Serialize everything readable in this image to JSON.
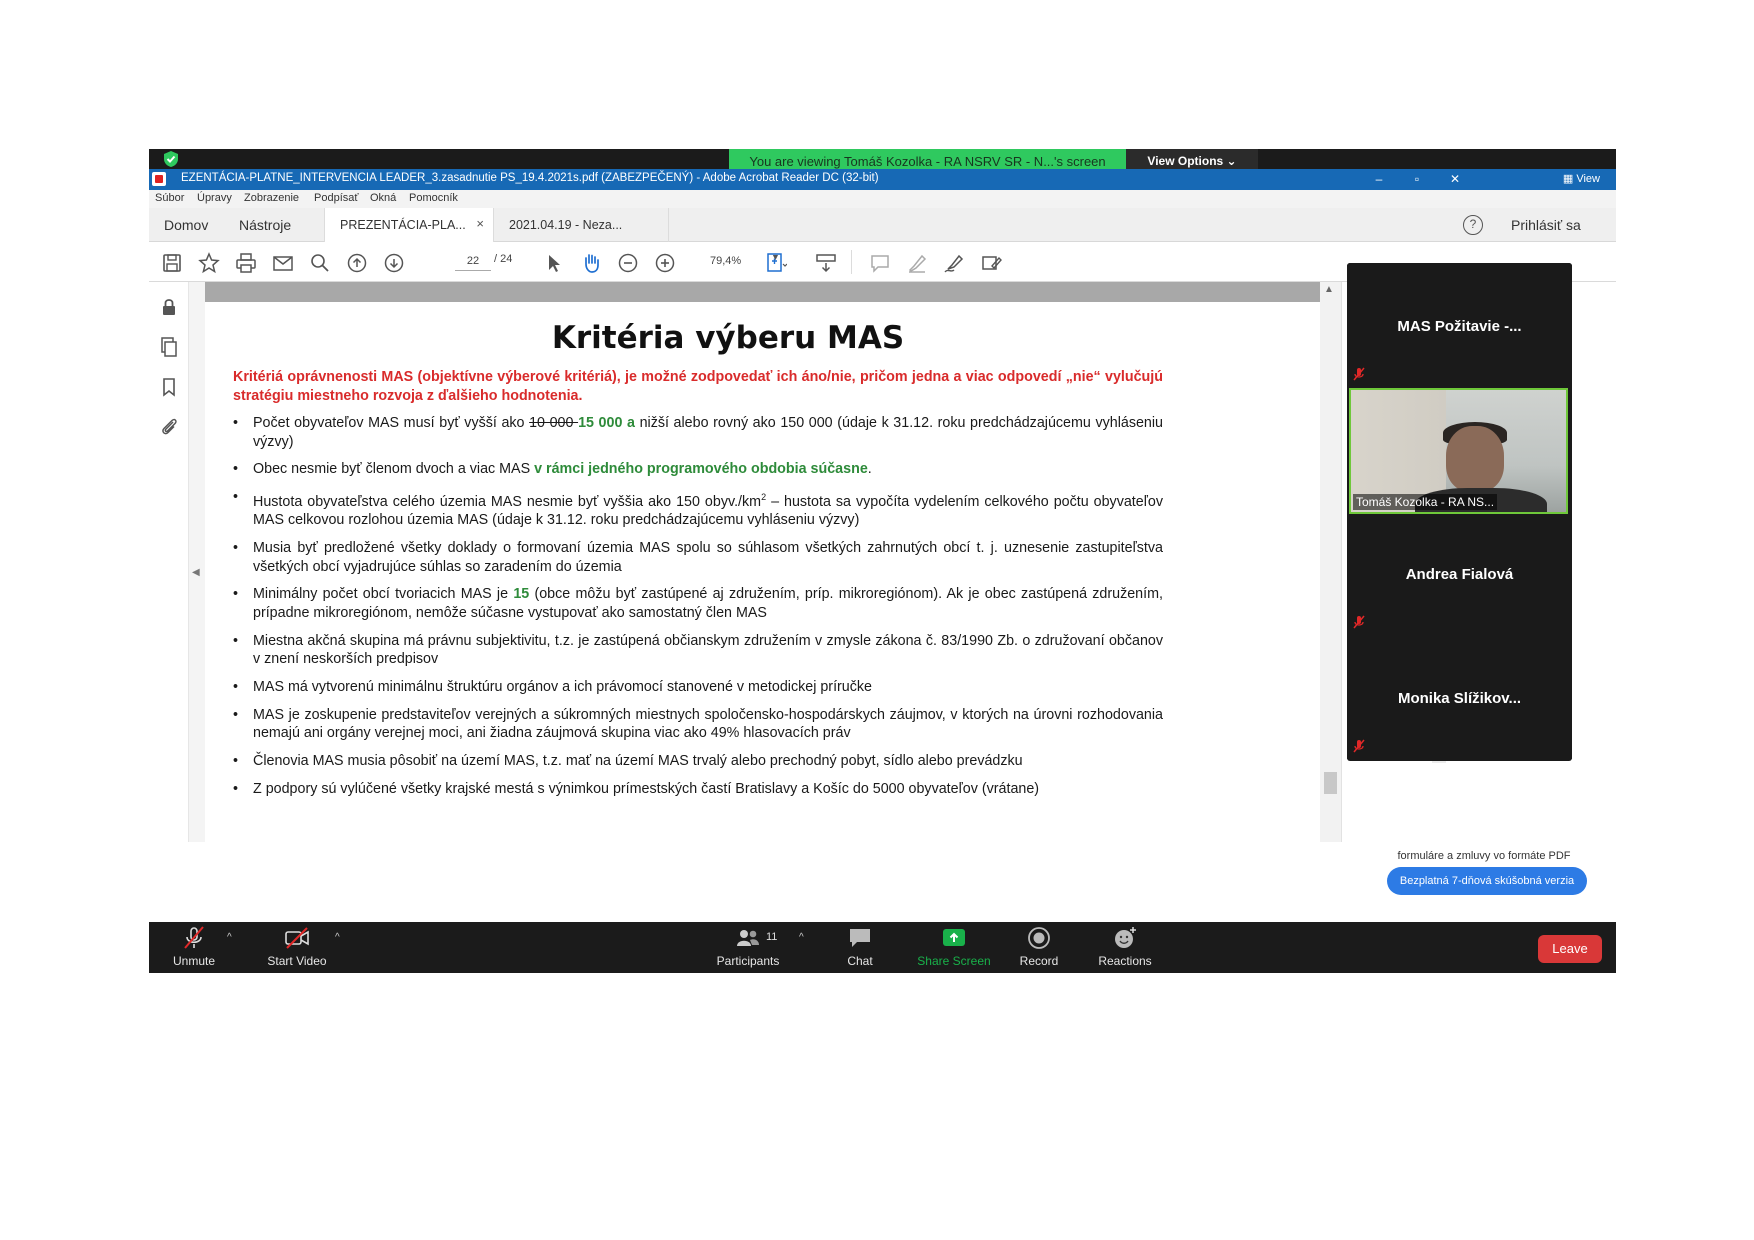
{
  "zoom": {
    "banner_text": "You are viewing Tomáš Kozolka - RA NSRV SR - N...'s screen",
    "view_options_label": "View Options ⌄",
    "view_label": "View",
    "participants_count": "11",
    "toolbar": {
      "unmute": "Unmute",
      "start_video": "Start Video",
      "participants": "Participants",
      "chat": "Chat",
      "share_screen": "Share Screen",
      "record": "Record",
      "reactions": "Reactions",
      "leave": "Leave"
    },
    "gallery": [
      {
        "name": "MAS Požitavie -..."
      },
      {
        "name": "Tomáš Kozolka - RA NS..."
      },
      {
        "name": "Andrea Fialová"
      },
      {
        "name": "Monika Slížikov..."
      }
    ],
    "colors": {
      "banner_green": "#2fc95f",
      "leave_red": "#d93838",
      "share_green": "#19b14a",
      "active_speaker": "#6fc83a"
    }
  },
  "acrobat": {
    "title": "EZENTÁCIA-PLATNE_INTERVENCIA LEADER_3.zasadnutie PS_19.4.2021s.pdf (ZABEZPEČENÝ) - Adobe Acrobat Reader DC (32-bit)",
    "menu": [
      "Súbor",
      "Úpravy",
      "Zobrazenie",
      "Podpísať",
      "Okná",
      "Pomocník"
    ],
    "nav_home": "Domov",
    "nav_tools": "Nástroje",
    "tabs": [
      {
        "label": "PREZENTÁCIA-PLA...",
        "close": "×"
      },
      {
        "label": "2021.04.19  - Neza..."
      }
    ],
    "help": "?",
    "sign_in": "Prihlásiť sa",
    "page_current": "22",
    "page_total": "/ 24",
    "zoom_level": "79,4%",
    "promo_text": "formuláre a zmluvy vo formáte PDF",
    "trial_button": "Bezplatná 7-dňová skúšobná verzia",
    "accent_color": "#1769b5"
  },
  "slide": {
    "title": "Kritéria výberu MAS",
    "intro": "Kritériá oprávnenosti MAS (objektívne výberové kritériá), je možné zodpovedať ich áno/nie, pričom jedna a viac odpovedí „nie“ vylučujú stratégiu miestneho rozvoja z ďalšieho hodnotenia.",
    "bullets": [
      {
        "pre": "Počet obyvateľov MAS musí byť vyšší ako ",
        "strike": "10 000 ",
        "green": " 15 000 a",
        "post": " nižší alebo rovný ako 150 000 (údaje k 31.12. roku predchádzajúcemu vyhláseniu výzvy)"
      },
      {
        "pre": "Obec nesmie byť členom dvoch a viac MAS ",
        "green": "v rámci  jedného programového obdobia súčasne",
        "post": "."
      },
      {
        "pre": "Hustota obyvateľstva celého územia MAS nesmie byť vyššia ako 150 obyv./km",
        "sup": "2",
        "post": " – hustota sa vypočíta vydelením celkového počtu obyvateľov MAS celkovou rozlohou územia MAS (údaje k 31.12. roku predchádzajúcemu vyhláseniu výzvy)"
      },
      {
        "pre": "Musia byť predložené všetky doklady o formovaní územia MAS spolu so súhlasom všetkých zahrnutých obcí t. j. uznesenie zastupiteľstva všetkých obcí vyjadrujúce súhlas so zaradením do územia"
      },
      {
        "pre": "Minimálny počet obcí tvoriacich MAS je ",
        "green": "15",
        "post": " (obce môžu byť zastúpené aj združením, príp. mikroregiónom). Ak je obec zastúpená združením, prípadne mikroregiónom, nemôže súčasne vystupovať ako samostatný člen MAS"
      },
      {
        "pre": "Miestna akčná skupina má právnu subjektivitu, t.z. je zastúpená občianskym združením v zmysle zákona č. 83/1990 Zb. o združovaní občanov v znení neskorších predpisov"
      },
      {
        "pre": "MAS má vytvorenú minimálnu štruktúru orgánov a ich právomocí stanovené v metodickej príručke"
      },
      {
        "pre": "MAS je zoskupenie predstaviteľov verejných a súkromných miestnych spoločensko-hospodárskych záujmov, v ktorých na úrovni rozhodovania nemajú ani orgány verejnej moci, ani žiadna záujmová skupina viac ako 49% hlasovacích práv"
      },
      {
        "pre": "Členovia MAS musia pôsobiť na území MAS, t.z. mať na území MAS trvalý alebo prechodný pobyt, sídlo alebo prevádzku"
      },
      {
        "pre": "Z podpory sú vylúčené všetky krajské mestá s výnimkou prímestských častí Bratislavy a Košíc do 5000 obyvateľov (vrátane)"
      }
    ]
  }
}
